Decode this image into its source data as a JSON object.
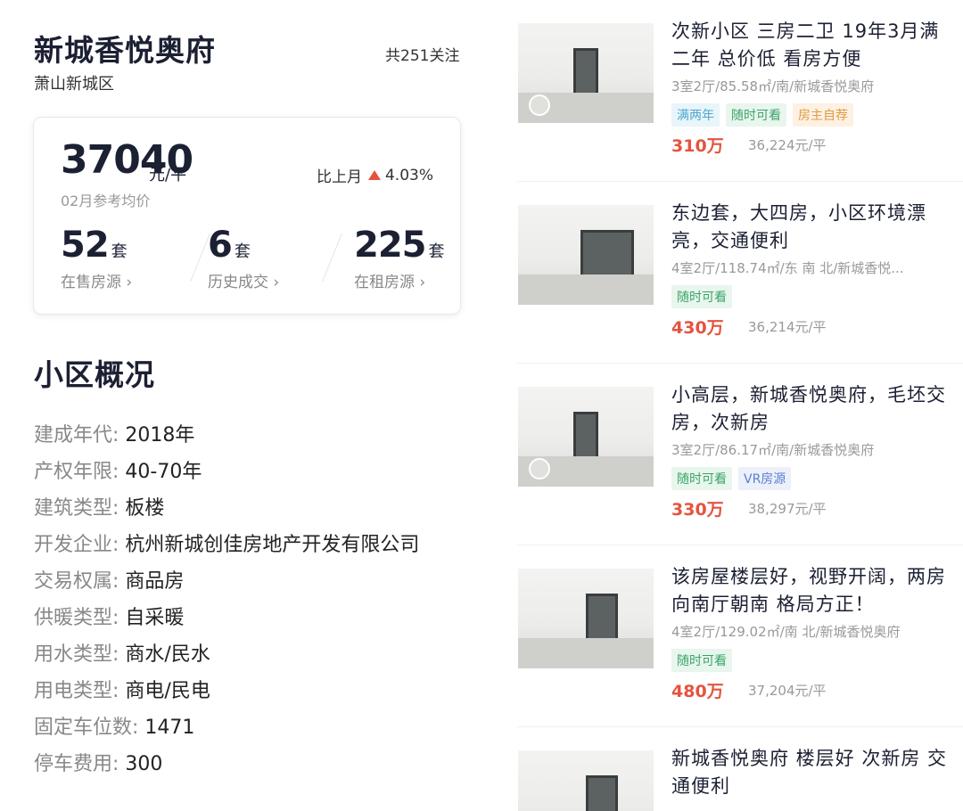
{
  "community": {
    "name": "新城香悦奥府",
    "district": "萧山新城区",
    "followers": "共251关注"
  },
  "price": {
    "value": "37040",
    "unit": "元/平",
    "caption": "02月参考均价",
    "mom_label": "比上月",
    "mom_value": "4.03%",
    "mom_direction": "up",
    "mom_color": "#e5533f"
  },
  "stats": [
    {
      "num": "52",
      "unit": "套",
      "label": "在售房源 ›"
    },
    {
      "num": "6",
      "unit": "套",
      "label": "历史成交 ›"
    },
    {
      "num": "225",
      "unit": "套",
      "label": "在租房源 ›"
    }
  ],
  "overview": {
    "title": "小区概况",
    "items": [
      {
        "k": "建成年代: ",
        "v": "2018年"
      },
      {
        "k": "产权年限: ",
        "v": "40-70年"
      },
      {
        "k": "建筑类型: ",
        "v": "板楼"
      },
      {
        "k": "开发企业: ",
        "v": "杭州新城创佳房地产开发有限公司"
      },
      {
        "k": "交易权属: ",
        "v": "商品房"
      },
      {
        "k": "供暖类型: ",
        "v": "自采暖"
      },
      {
        "k": "用水类型: ",
        "v": "商水/民水"
      },
      {
        "k": "用电类型: ",
        "v": "商电/民电"
      },
      {
        "k": "固定车位数: ",
        "v": "1471"
      },
      {
        "k": "停车费用: ",
        "v": "300"
      }
    ]
  },
  "listings": [
    {
      "title": "次新小区 三房二卫 19年3月满二年 总价低 看房方便",
      "desc": "3室2厅/85.58㎡/南/新城香悦奥府",
      "tags": [
        "满两年",
        "随时可看",
        "房主自荐"
      ],
      "price": "310万",
      "unit_price": "36,224元/平"
    },
    {
      "title": "东边套，大四房，小区环境漂亮，交通便利",
      "desc": "4室2厅/118.74㎡/东 南 北/新城香悦...",
      "tags": [
        "随时可看"
      ],
      "price": "430万",
      "unit_price": "36,214元/平"
    },
    {
      "title": "小高层，新城香悦奥府，毛坯交房，次新房",
      "desc": "3室2厅/86.17㎡/南/新城香悦奥府",
      "tags": [
        "随时可看",
        "VR房源"
      ],
      "price": "330万",
      "unit_price": "38,297元/平"
    },
    {
      "title": "该房屋楼层好，视野开阔，两房向南厅朝南 格局方正！",
      "desc": "4室2厅/129.02㎡/南 北/新城香悦奥府",
      "tags": [
        "随时可看"
      ],
      "price": "480万",
      "unit_price": "37,204元/平"
    },
    {
      "title": "新城香悦奥府 楼层好 次新房 交通便利",
      "desc": "",
      "tags": [],
      "price": "",
      "unit_price": ""
    }
  ],
  "icons": {
    "mom_arrow": "triangle-up-icon",
    "media": "play-icon"
  }
}
